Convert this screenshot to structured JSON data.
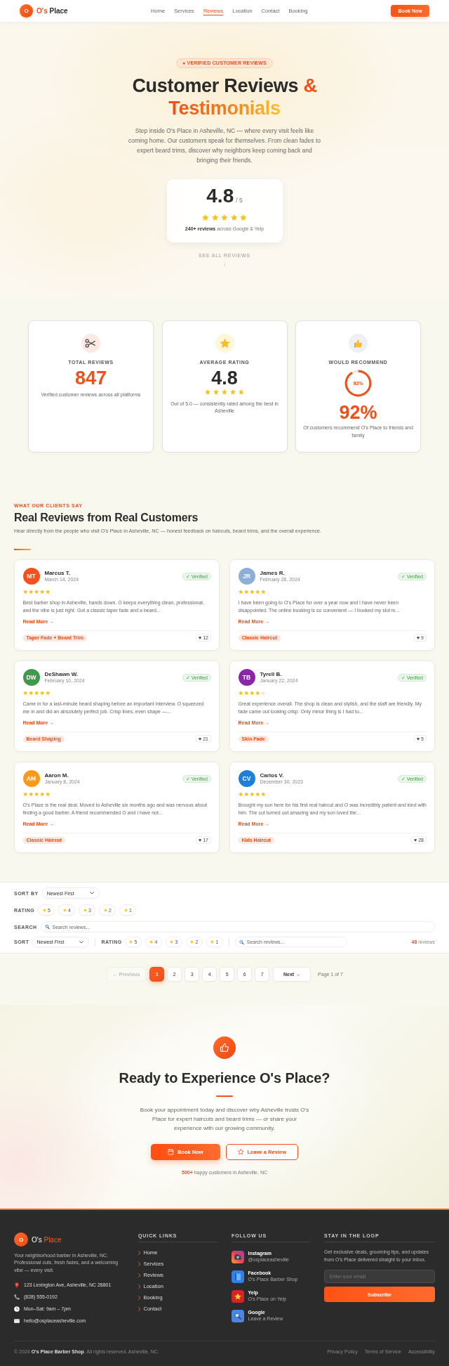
{
  "header": {
    "logo": "O",
    "brand": {
      "first": "O's",
      "second": "Place"
    },
    "nav": [
      {
        "label": "Home",
        "selected": false
      },
      {
        "label": "Services",
        "selected": false
      },
      {
        "label": "Reviews",
        "selected": true
      },
      {
        "label": "Location",
        "selected": false
      },
      {
        "label": "Contact",
        "selected": false
      },
      {
        "label": "Booking",
        "selected": false
      }
    ],
    "button": "Book Now"
  },
  "hero": {
    "badge": "● VERIFIED CUSTOMER REVIEWS",
    "title_parts": [
      {
        "kind": "plain",
        "text": "Customer Reviews"
      },
      {
        "kind": "accent",
        "text": "&"
      },
      {
        "kind": "gradient",
        "text": "Testimonials"
      }
    ],
    "text": "Step inside O's Place in Asheville, NC — where every visit feels like coming home. Our customers speak for themselves. From clean fades to expert beard trims, discover why neighbors keep coming back and bringing their friends.",
    "rating": {
      "score": "4.8",
      "out_of": "/ 5",
      "stars": 5,
      "note": "**240+ reviews** across Google & Yelp"
    },
    "scroll_hint": "SEE ALL REVIEWS",
    "scroll_arrow": "↓"
  },
  "stats": [
    {
      "kind": "count",
      "label": "TOTAL REVIEWS",
      "value": "847",
      "text": "Verified customer reviews across all platforms"
    },
    {
      "kind": "rating",
      "label": "AVERAGE RATING",
      "value": "4.8",
      "stars": 4.8,
      "text": "Out of 5.0 — consistently rated among the best in Asheville"
    },
    {
      "kind": "percent",
      "label": "WOULD RECOMMEND",
      "chart_data": {
        "type": "donut",
        "values": [
          92,
          8
        ]
      },
      "ring_label": "92%",
      "value": "92%",
      "text": "Of customers recommend O's Place to friends and family"
    }
  ],
  "reviews": {
    "eyebrow": "WHAT OUR CLIENTS SAY",
    "title": "Real Reviews from Real Customers",
    "text": "Hear directly from the people who visit O's Place in Asheville, NC — honest feedback on haircuts, beard trims, and the overall experience.",
    "items": [
      {
        "initials": "MT",
        "color": "#f4511e",
        "name": "Marcus T.",
        "date": "March 14, 2024",
        "badge": "✓ Verified",
        "stars": 5,
        "text": "Best barber shop in Asheville, hands down. O keeps everything clean, professional, and the vibe is just right. Got a classic taper fade and a beard...",
        "read_more": "Read More →",
        "tag": "Taper Fade + Beard Trim",
        "likes": "♥ 12"
      },
      {
        "initials": "JR",
        "color": "#8eaed6",
        "name": "James R.",
        "date": "February 28, 2024",
        "badge": "✓ Verified",
        "stars": 5,
        "text": "I have been going to O's Place for over a year now and I have never been disappointed. The online booking is so convenient — I booked my slot in...",
        "read_more": "Read More →",
        "tag": "Classic Haircut",
        "likes": "♥ 9"
      },
      {
        "initials": "DW",
        "color": "#3f9b4a",
        "name": "DeShawn W.",
        "date": "February 10, 2024",
        "badge": "✓ Verified",
        "stars": 5,
        "text": "Came in for a last-minute beard shaping before an important interview. O squeezed me in and did an absolutely perfect job. Crisp lines, even shape —...",
        "read_more": "Read More →",
        "tag": "Beard Shaping",
        "likes": "♥ 21"
      },
      {
        "initials": "TB",
        "color": "#8e24aa",
        "name": "Tyrell B.",
        "date": "January 22, 2024",
        "badge": "✓ Verified",
        "stars": 4,
        "text": "Great experience overall. The shop is clean and stylish, and the staff are friendly. My fade came out looking crisp. Only minor thing is I had to...",
        "read_more": "Read More →",
        "tag": "Skin Fade",
        "likes": "♥ 5"
      },
      {
        "initials": "AM",
        "color": "#f99a1c",
        "name": "Aaron M.",
        "date": "January 8, 2024",
        "badge": "✓ Verified",
        "stars": 5,
        "text": "O's Place is the real deal. Moved to Asheville six months ago and was nervous about finding a good barber. A friend recommended O and I have not...",
        "read_more": "Read More →",
        "tag": "Classic Haircut",
        "likes": "♥ 17"
      },
      {
        "initials": "CV",
        "color": "#1e7fd8",
        "name": "Carlos V.",
        "date": "December 30, 2023",
        "badge": "✓ Verified",
        "stars": 5,
        "text": "Brought my son here for his first real haircut and O was incredibly patient and kind with him. The cut turned out amazing and my son loved the...",
        "read_more": "Read More →",
        "tag": "Kids Haircut",
        "likes": "♥ 28"
      }
    ]
  },
  "filters": {
    "sort_label": "SORT BY",
    "sort_value": "Newest First",
    "rating_label": "RATING",
    "ratings": [
      {
        "label": "5",
        "selected": false
      },
      {
        "label": "4",
        "selected": false
      },
      {
        "label": "3",
        "selected": false
      },
      {
        "label": "2",
        "selected": false
      },
      {
        "label": "1",
        "selected": false
      }
    ],
    "search_label": "SEARCH",
    "search_placeholder": "Search reviews..."
  },
  "filter_bar": {
    "sort_label": "SORT",
    "sort_value": "Newest First",
    "rating_label": "RATING",
    "ratings": [
      {
        "label": "5",
        "selected": false
      },
      {
        "label": "4",
        "selected": false
      },
      {
        "label": "3",
        "selected": false
      },
      {
        "label": "2",
        "selected": false
      },
      {
        "label": "1",
        "selected": false
      }
    ],
    "search_placeholder": "Search reviews...",
    "count": "**48** reviews"
  },
  "pagination": {
    "previous": {
      "label": "← Previous",
      "disabled": true
    },
    "pages": [
      {
        "label": "1",
        "selected": true
      },
      {
        "label": "2",
        "selected": false
      },
      {
        "label": "3",
        "selected": false
      },
      {
        "label": "4",
        "selected": false
      },
      {
        "label": "5",
        "selected": false
      },
      {
        "label": "6",
        "selected": false
      },
      {
        "label": "7",
        "selected": false
      }
    ],
    "next": {
      "label": "Next →",
      "disabled": false
    },
    "info": "Page 1 of 7"
  },
  "cta": {
    "title": "Ready to Experience O's Place?",
    "text": "Book your appointment today and discover why Asheville trusts O's Place for expert haircuts and beard trims — or share your experience with our growing community.",
    "buttons": [
      {
        "kind": "primary",
        "label": "Book Now"
      },
      {
        "kind": "outline",
        "label": "Leave a Review"
      }
    ],
    "note": "**500+** happy customers in Asheville, NC"
  },
  "footer": {
    "logo": "O",
    "brand": {
      "first": "O's",
      "second": "Place"
    },
    "about": "Your neighborhood barber in Asheville, NC. Professional cuts, fresh fades, and a welcoming vibe — every visit.",
    "contacts": [
      {
        "kind": "address",
        "text": "123 Lexington Ave, Asheville, NC 28801"
      },
      {
        "kind": "phone",
        "text": "(828) 555-0192"
      },
      {
        "kind": "hours",
        "text": "Mon–Sat: 9am – 7pm"
      },
      {
        "kind": "email",
        "text": "hello@osplaceasheville.com"
      }
    ],
    "quick_links": {
      "title": "QUICK LINKS",
      "items": [
        "Home",
        "Services",
        "Reviews",
        "Location",
        "Booking",
        "Contact"
      ]
    },
    "follow": {
      "title": "FOLLOW US",
      "items": [
        {
          "kind": "instagram",
          "name": "Instagram",
          "handle": "@osplaceasheville"
        },
        {
          "kind": "facebook",
          "name": "Facebook",
          "handle": "O's Place Barber Shop"
        },
        {
          "kind": "yelp",
          "name": "Yelp",
          "handle": "O's Place on Yelp"
        },
        {
          "kind": "google",
          "name": "Google",
          "handle": "Leave a Review"
        }
      ]
    },
    "newsletter": {
      "title": "STAY IN THE LOOP",
      "text": "Get exclusive deals, grooming tips, and updates from O's Place delivered straight to your inbox.",
      "placeholder": "Enter your email",
      "button": "Subscribe"
    },
    "copyright": "© 2024 **O's Place Barber Shop**. All rights reserved. Asheville, NC.",
    "legal_links": [
      "Privacy Policy",
      "Terms of Service",
      "Accessibility"
    ]
  }
}
